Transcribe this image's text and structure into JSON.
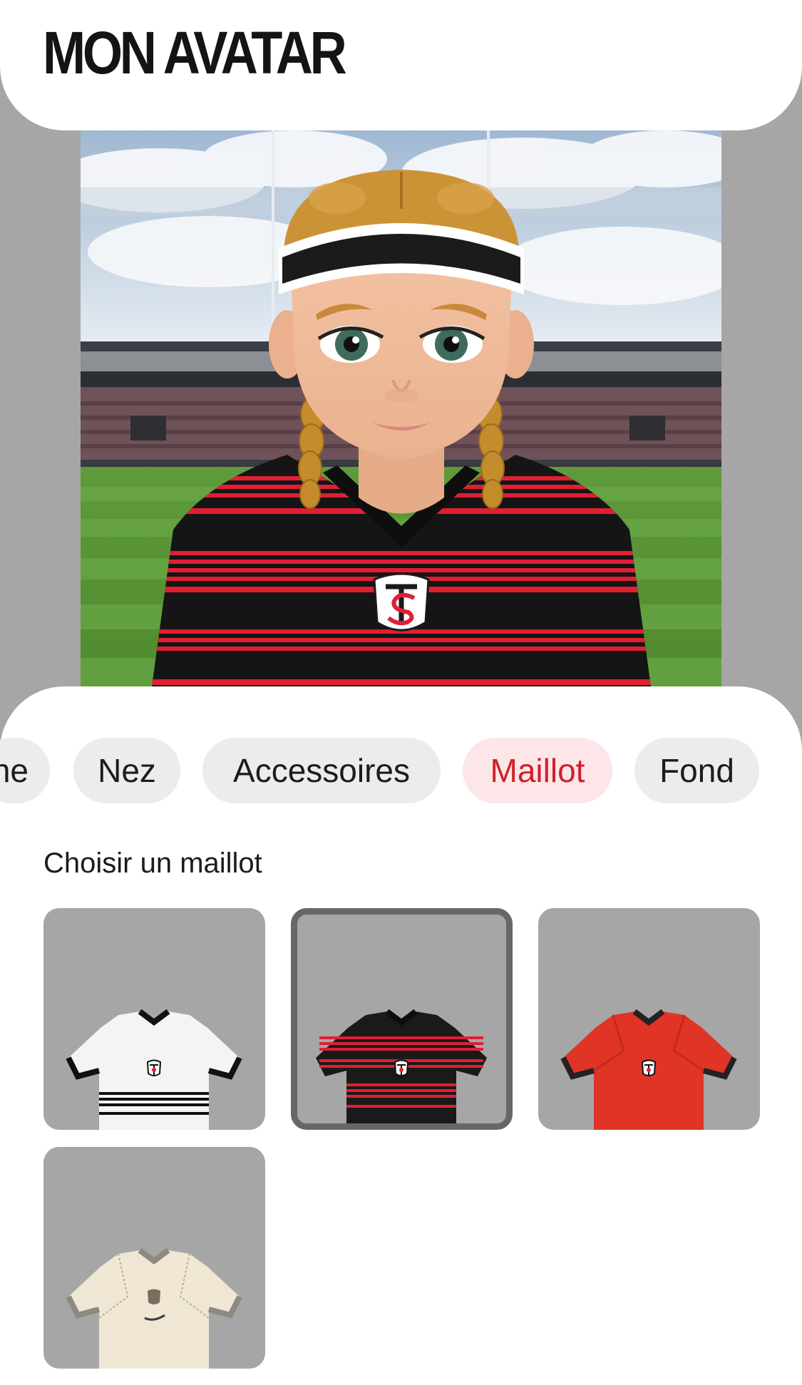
{
  "header": {
    "title": "MON AVATAR"
  },
  "tabs": [
    {
      "label": "he",
      "active": false
    },
    {
      "label": "Nez",
      "active": false
    },
    {
      "label": "Accessoires",
      "active": false
    },
    {
      "label": "Maillot",
      "active": true
    },
    {
      "label": "Fond",
      "active": false
    }
  ],
  "jerseys": {
    "section_label": "Choisir un maillot",
    "items": [
      {
        "name": "white-jersey",
        "selected": false,
        "color": "#f4f4f4"
      },
      {
        "name": "black-red-striped-jersey",
        "selected": true,
        "color": "#1a1a1a"
      },
      {
        "name": "red-jersey",
        "selected": false,
        "color": "#e03426"
      },
      {
        "name": "cream-jersey",
        "selected": false,
        "color": "#efe6d4"
      }
    ]
  },
  "colors": {
    "accent": "#d11f2c",
    "accent_bg": "#fde6e8",
    "tab_bg": "#ececec",
    "tile_bg": "#a6a6a6",
    "selected_border": "#676767"
  }
}
